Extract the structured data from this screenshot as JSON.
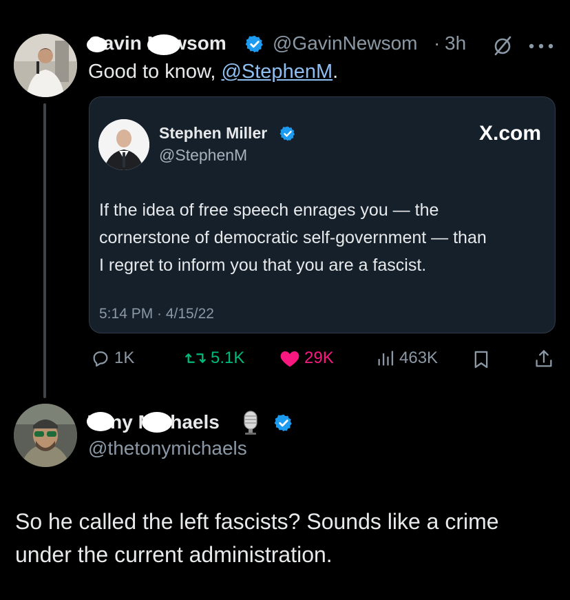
{
  "tweet1": {
    "name": "Gavin Newsom",
    "handle": "@GavinNewsom",
    "separator": "·",
    "time": "3h",
    "text_prefix": "Good to know, ",
    "mention": "@StephenM",
    "text_suffix": ".",
    "quoted": {
      "name": "Stephen Miller",
      "handle": "@StephenM",
      "source": "X.com",
      "body_lines": [
        "If the idea of free speech enrages you — the",
        "cornerstone of democratic self-government — than",
        "I regret to inform you that you are a fascist."
      ],
      "timestamp": "5:14 PM · 4/15/22"
    },
    "stats": {
      "replies": "1K",
      "reposts": "5.1K",
      "likes": "29K",
      "views": "463K"
    }
  },
  "tweet2": {
    "name": "Tony Michaels",
    "handle": "@thetonymichaels",
    "text_lines": [
      "So he called the left fascists? Sounds like a crime",
      "under the current administration."
    ]
  },
  "icons": {
    "verified": "verified-badge-icon",
    "grok": "slashed-circle-icon",
    "more": "more-dots-icon",
    "reply": "reply-bubble-icon",
    "repost": "repost-icon",
    "like": "heart-icon",
    "views": "views-bars-icon",
    "bookmark": "bookmark-icon",
    "share": "share-icon",
    "microphone": "microphone-emoji-icon"
  },
  "colors": {
    "background": "#000000",
    "card_bg": "#15202b",
    "verified_blue": "#1d9bf0",
    "like_pink": "#f91880",
    "repost_green": "#00ba7c",
    "link": "#8fbff0"
  }
}
